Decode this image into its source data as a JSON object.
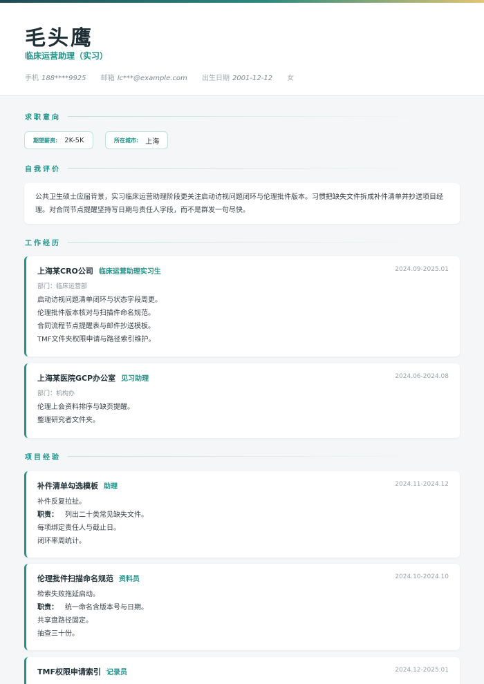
{
  "header": {
    "name": "毛头鹰",
    "role": "临床运营助理（实习）",
    "contacts": [
      {
        "label": "手机",
        "value": "188****9925"
      },
      {
        "label": "邮箱",
        "value": "lc***@example.com"
      },
      {
        "label": "出生日期",
        "value": "2001-12-12"
      },
      {
        "label": "",
        "value": "女"
      }
    ]
  },
  "intent": {
    "title": "求职意向",
    "chips": [
      {
        "label": "期望薪资:",
        "value": "2K-5K"
      },
      {
        "label": "所在城市:",
        "value": "上海"
      }
    ]
  },
  "summary": {
    "title": "自我评价",
    "text": "公共卫生硕士应届背景，实习临床运营助理阶段更关注启动访视问题闭环与伦理批件版本。习惯把缺失文件拆成补件清单并抄送项目经理。对合同节点提醒坚持写日期与责任人字段，而不是群发一句尽快。"
  },
  "work": {
    "title": "工作经历",
    "items": [
      {
        "company": "上海某CRO公司",
        "position": "临床运营助理实习生",
        "date": "2024.09-2025.01",
        "dept": "部门：临床运营部",
        "lines": [
          "启动访视问题清单闭环与状态字段周更。",
          "伦理批件版本核对与扫描件命名规范。",
          "合同流程节点提醒表与邮件抄送模板。",
          "TMF文件夹权限申请与路径索引维护。"
        ]
      },
      {
        "company": "上海某医院GCP办公室",
        "position": "见习助理",
        "date": "2024.06-2024.08",
        "dept": "部门：机构办",
        "lines": [
          "伦理上会资料排序与缺页提醒。",
          "整理研究者文件夹。"
        ]
      }
    ]
  },
  "projects": {
    "title": "项目经验",
    "duty_label": "职责：",
    "items": [
      {
        "name": "补件清单勾选模板",
        "role": "助理",
        "date": "2024.11-2024.12",
        "background": "补件反复拉扯。",
        "duty": "列出二十类常见缺失文件。",
        "lines": [
          "每项绑定责任人与截止日。",
          "闭环率周统计。"
        ]
      },
      {
        "name": "伦理批件扫描命名规范",
        "role": "资料员",
        "date": "2024.10-2024.10",
        "background": "检索失败拖延启动。",
        "duty": "统一命名含版本号与日期。",
        "lines": [
          "共享盘路径固定。",
          "抽查三十份。"
        ]
      },
      {
        "name": "TMF权限申请索引",
        "role": "记录员",
        "date": "2024.12-2025.01"
      }
    ]
  },
  "colors": {
    "accent": "#23938a",
    "title": "#1f2f36",
    "background": "#f4f6f7"
  }
}
